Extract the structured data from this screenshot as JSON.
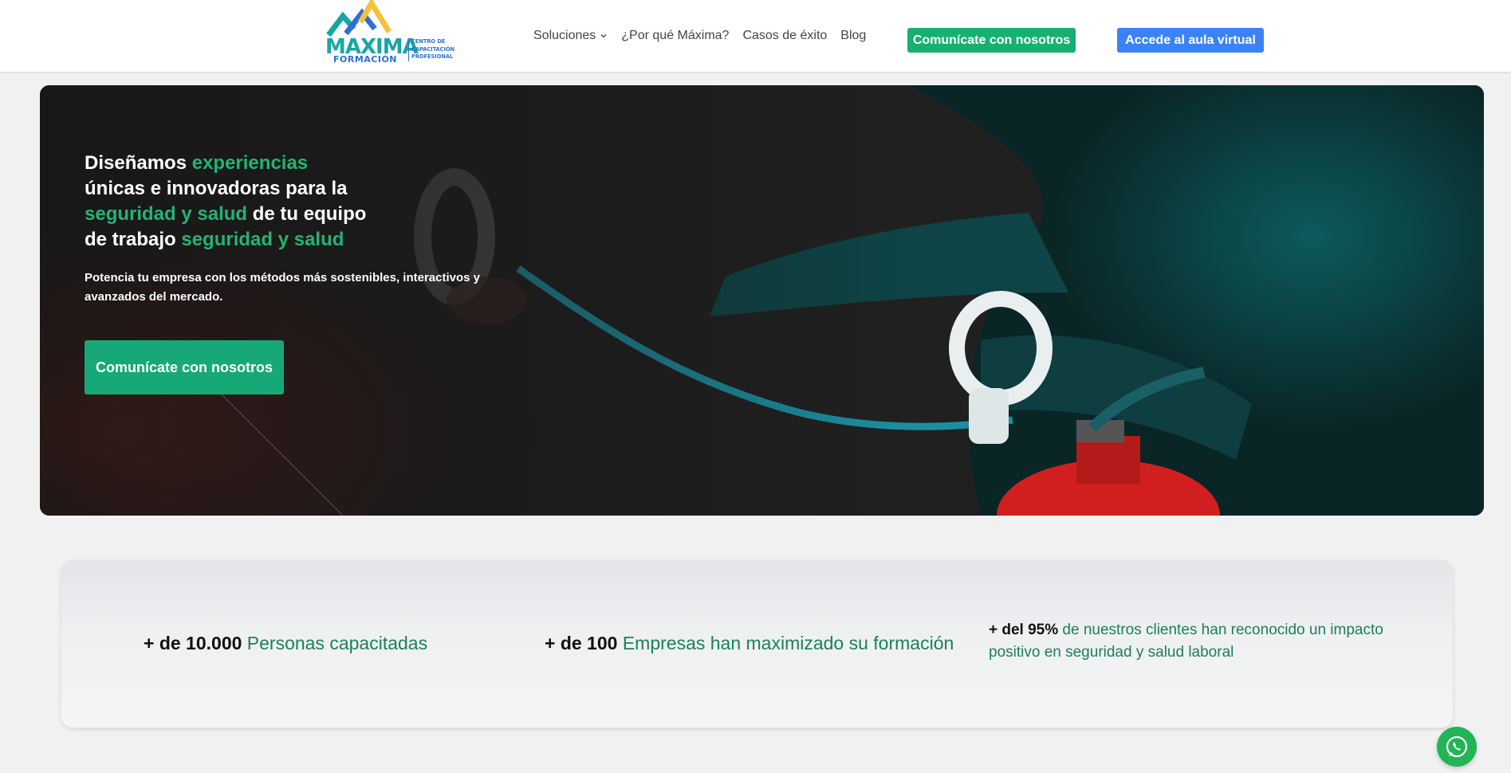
{
  "header": {
    "logo": {
      "word": "MAXIMA",
      "sub": "FORMACIÓN",
      "tag_lines": [
        "CENTRO DE",
        "CAPACITACIÓN",
        "PROFESIONAL"
      ]
    },
    "nav": [
      {
        "label": "Soluciones",
        "icon": "chevron-down-icon"
      },
      {
        "label": "¿Por qué Máxima?"
      },
      {
        "label": "Casos de éxito"
      },
      {
        "label": "Blog"
      }
    ],
    "contact_button": "Comunícate con nosotros",
    "aula_button": "Accede al aula virtual"
  },
  "hero": {
    "title": {
      "w1": "Diseñamos ",
      "g1": "experiencias",
      "w2": "únicas e innovadoras para la",
      "g2": "seguridad y salud",
      "w3": " de tu equipo",
      "w4": "de trabajo ",
      "g3": "seguridad y salud"
    },
    "subtitle": "Potencia tu empresa con los métodos más sostenibles, interactivos y avanzados del mercado.",
    "cta": "Comunícate con nosotros"
  },
  "stats": [
    {
      "bold": "+ de 10.000",
      "text": " Personas capacitadas"
    },
    {
      "bold": "+ de 100",
      "text": " Empresas han maximizado su formación"
    },
    {
      "bold": "+ del 95%",
      "text": " de nuestros clientes han reconocido un impacto positivo en seguridad y salud laboral"
    }
  ],
  "colors": {
    "accent_green": "#16b072",
    "accent_blue": "#3b82f6",
    "text_green": "#1e7f57",
    "whatsapp": "#22b455"
  },
  "floating": {
    "icon": "whatsapp-icon"
  }
}
